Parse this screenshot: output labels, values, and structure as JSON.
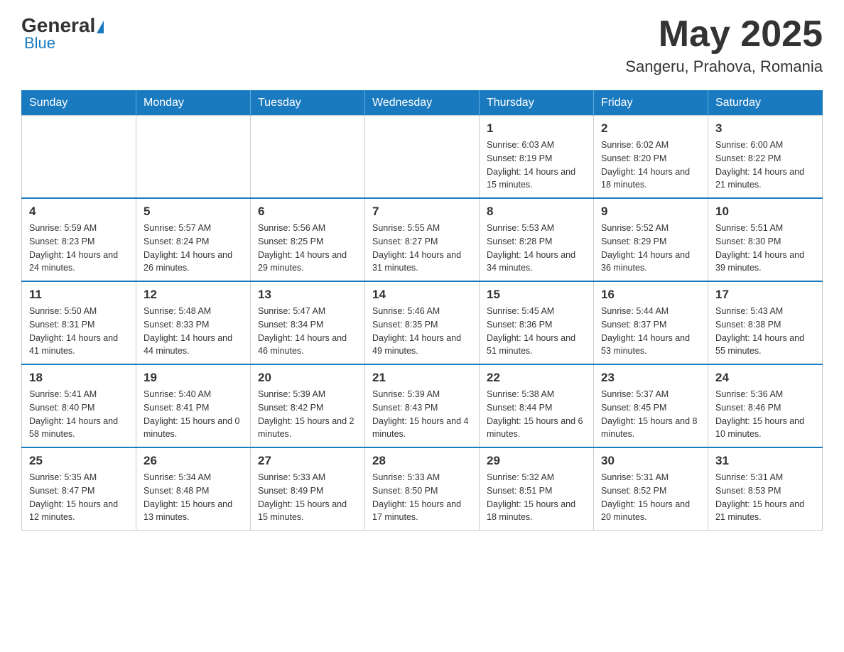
{
  "header": {
    "logo_general": "General",
    "logo_blue": "Blue",
    "title": "May 2025",
    "subtitle": "Sangeru, Prahova, Romania"
  },
  "calendar": {
    "days_of_week": [
      "Sunday",
      "Monday",
      "Tuesday",
      "Wednesday",
      "Thursday",
      "Friday",
      "Saturday"
    ],
    "weeks": [
      [
        {
          "day": "",
          "info": ""
        },
        {
          "day": "",
          "info": ""
        },
        {
          "day": "",
          "info": ""
        },
        {
          "day": "",
          "info": ""
        },
        {
          "day": "1",
          "info": "Sunrise: 6:03 AM\nSunset: 8:19 PM\nDaylight: 14 hours and 15 minutes."
        },
        {
          "day": "2",
          "info": "Sunrise: 6:02 AM\nSunset: 8:20 PM\nDaylight: 14 hours and 18 minutes."
        },
        {
          "day": "3",
          "info": "Sunrise: 6:00 AM\nSunset: 8:22 PM\nDaylight: 14 hours and 21 minutes."
        }
      ],
      [
        {
          "day": "4",
          "info": "Sunrise: 5:59 AM\nSunset: 8:23 PM\nDaylight: 14 hours and 24 minutes."
        },
        {
          "day": "5",
          "info": "Sunrise: 5:57 AM\nSunset: 8:24 PM\nDaylight: 14 hours and 26 minutes."
        },
        {
          "day": "6",
          "info": "Sunrise: 5:56 AM\nSunset: 8:25 PM\nDaylight: 14 hours and 29 minutes."
        },
        {
          "day": "7",
          "info": "Sunrise: 5:55 AM\nSunset: 8:27 PM\nDaylight: 14 hours and 31 minutes."
        },
        {
          "day": "8",
          "info": "Sunrise: 5:53 AM\nSunset: 8:28 PM\nDaylight: 14 hours and 34 minutes."
        },
        {
          "day": "9",
          "info": "Sunrise: 5:52 AM\nSunset: 8:29 PM\nDaylight: 14 hours and 36 minutes."
        },
        {
          "day": "10",
          "info": "Sunrise: 5:51 AM\nSunset: 8:30 PM\nDaylight: 14 hours and 39 minutes."
        }
      ],
      [
        {
          "day": "11",
          "info": "Sunrise: 5:50 AM\nSunset: 8:31 PM\nDaylight: 14 hours and 41 minutes."
        },
        {
          "day": "12",
          "info": "Sunrise: 5:48 AM\nSunset: 8:33 PM\nDaylight: 14 hours and 44 minutes."
        },
        {
          "day": "13",
          "info": "Sunrise: 5:47 AM\nSunset: 8:34 PM\nDaylight: 14 hours and 46 minutes."
        },
        {
          "day": "14",
          "info": "Sunrise: 5:46 AM\nSunset: 8:35 PM\nDaylight: 14 hours and 49 minutes."
        },
        {
          "day": "15",
          "info": "Sunrise: 5:45 AM\nSunset: 8:36 PM\nDaylight: 14 hours and 51 minutes."
        },
        {
          "day": "16",
          "info": "Sunrise: 5:44 AM\nSunset: 8:37 PM\nDaylight: 14 hours and 53 minutes."
        },
        {
          "day": "17",
          "info": "Sunrise: 5:43 AM\nSunset: 8:38 PM\nDaylight: 14 hours and 55 minutes."
        }
      ],
      [
        {
          "day": "18",
          "info": "Sunrise: 5:41 AM\nSunset: 8:40 PM\nDaylight: 14 hours and 58 minutes."
        },
        {
          "day": "19",
          "info": "Sunrise: 5:40 AM\nSunset: 8:41 PM\nDaylight: 15 hours and 0 minutes."
        },
        {
          "day": "20",
          "info": "Sunrise: 5:39 AM\nSunset: 8:42 PM\nDaylight: 15 hours and 2 minutes."
        },
        {
          "day": "21",
          "info": "Sunrise: 5:39 AM\nSunset: 8:43 PM\nDaylight: 15 hours and 4 minutes."
        },
        {
          "day": "22",
          "info": "Sunrise: 5:38 AM\nSunset: 8:44 PM\nDaylight: 15 hours and 6 minutes."
        },
        {
          "day": "23",
          "info": "Sunrise: 5:37 AM\nSunset: 8:45 PM\nDaylight: 15 hours and 8 minutes."
        },
        {
          "day": "24",
          "info": "Sunrise: 5:36 AM\nSunset: 8:46 PM\nDaylight: 15 hours and 10 minutes."
        }
      ],
      [
        {
          "day": "25",
          "info": "Sunrise: 5:35 AM\nSunset: 8:47 PM\nDaylight: 15 hours and 12 minutes."
        },
        {
          "day": "26",
          "info": "Sunrise: 5:34 AM\nSunset: 8:48 PM\nDaylight: 15 hours and 13 minutes."
        },
        {
          "day": "27",
          "info": "Sunrise: 5:33 AM\nSunset: 8:49 PM\nDaylight: 15 hours and 15 minutes."
        },
        {
          "day": "28",
          "info": "Sunrise: 5:33 AM\nSunset: 8:50 PM\nDaylight: 15 hours and 17 minutes."
        },
        {
          "day": "29",
          "info": "Sunrise: 5:32 AM\nSunset: 8:51 PM\nDaylight: 15 hours and 18 minutes."
        },
        {
          "day": "30",
          "info": "Sunrise: 5:31 AM\nSunset: 8:52 PM\nDaylight: 15 hours and 20 minutes."
        },
        {
          "day": "31",
          "info": "Sunrise: 5:31 AM\nSunset: 8:53 PM\nDaylight: 15 hours and 21 minutes."
        }
      ]
    ]
  }
}
